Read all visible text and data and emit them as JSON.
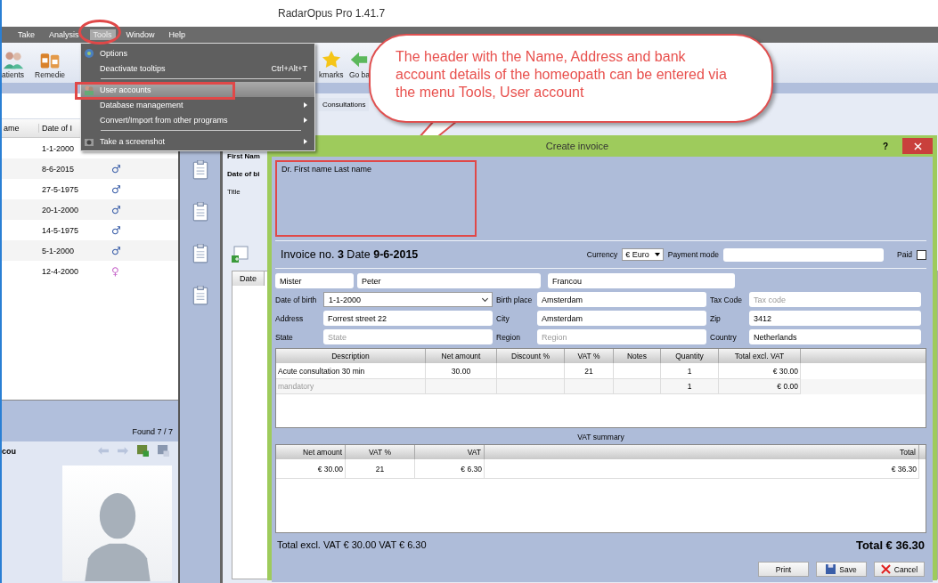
{
  "window": {
    "title": "RadarOpus Pro 1.41.7"
  },
  "menu_bar": [
    {
      "label": "Take",
      "selected": false
    },
    {
      "label": "Analysis",
      "selected": false
    },
    {
      "label": "Tools",
      "selected": true
    },
    {
      "label": "Window",
      "selected": false
    },
    {
      "label": "Help",
      "selected": false
    }
  ],
  "toolbar": [
    {
      "label": "atients"
    },
    {
      "label": "Remedie"
    },
    {
      "label": "kmarks"
    },
    {
      "label": "Go ba"
    }
  ],
  "tools_menu": [
    {
      "label": "Options",
      "submenu": false,
      "highlighted": false,
      "separator_after": false
    },
    {
      "label": "Deactivate tooltips",
      "shortcut": "Ctrl+Alt+T",
      "submenu": false,
      "highlighted": false,
      "separator_after": true
    },
    {
      "label": "User accounts",
      "submenu": false,
      "highlighted": true,
      "separator_after": false
    },
    {
      "label": "Database management",
      "submenu": true,
      "highlighted": false,
      "separator_after": false
    },
    {
      "label": "Convert/Import from other programs",
      "submenu": true,
      "highlighted": false,
      "separator_after": true
    },
    {
      "label": "Take a screenshot",
      "submenu": true,
      "highlighted": false,
      "separator_after": false
    }
  ],
  "patients": {
    "columns": [
      "ame",
      "Date of I"
    ],
    "rows": [
      {
        "date": "1-1-2000"
      },
      {
        "date": "8-6-2015",
        "symbol": "♂",
        "kind": "male"
      },
      {
        "date": "27-5-1975",
        "symbol": "♂",
        "kind": "male"
      },
      {
        "date": "20-1-2000",
        "symbol": "♂",
        "kind": "male"
      },
      {
        "date": "14-5-1975",
        "symbol": "♂",
        "kind": "male"
      },
      {
        "date": "5-1-2000",
        "symbol": "♂",
        "kind": "male"
      },
      {
        "date": "12-4-2000",
        "symbol": "♀",
        "kind": "female"
      }
    ],
    "found": "Found  7  /  7",
    "patient_name": "cou"
  },
  "consultations": {
    "tab": "Consultations",
    "labels": [
      "First Nam",
      "Date of bi",
      "Title"
    ],
    "column": "Date"
  },
  "callout": "The header with the Name, Address and bank account details  of the homeopath can be entered via the menu Tools,  User account",
  "dialog": {
    "title": "Create invoice",
    "help": "?",
    "header_text": "Dr. First name Last name",
    "invoice_line": "Invoice no. **3** Date **9-6-2015**",
    "currency_label": "Currency",
    "currency": "€ Euro",
    "payment_mode_label": "Payment mode",
    "paid_label": "Paid",
    "paid": false,
    "name_fields": [
      "Mister",
      "Peter",
      "Francou"
    ],
    "person_fields": [
      {
        "label": "Date of birth",
        "value": "1-1-2000",
        "kind": "select"
      },
      {
        "label": "Birth place",
        "value": "Amsterdam",
        "kind": "text"
      },
      {
        "label": "Tax Code",
        "placeholder": "Tax code",
        "kind": "text"
      },
      {
        "label": "Address",
        "value": "Forrest street 22",
        "kind": "text"
      },
      {
        "label": "City",
        "value": "Amsterdam",
        "kind": "text"
      },
      {
        "label": "Zip",
        "value": "3412",
        "kind": "text"
      },
      {
        "label": "State",
        "placeholder": "State",
        "kind": "text"
      },
      {
        "label": "Region",
        "placeholder": "Region",
        "kind": "text"
      },
      {
        "label": "Country",
        "value": "Netherlands",
        "kind": "text"
      }
    ],
    "items": {
      "columns": [
        "Description",
        "Net amount",
        "Discount %",
        "VAT %",
        "Notes",
        "Quantity",
        "Total excl. VAT"
      ],
      "rows": [
        {
          "description": "Acute consultation 30 min",
          "net_amount": "30.00",
          "vat_pct": "21",
          "quantity": "1",
          "total": "€ 30.00"
        },
        {
          "description_placeholder": "mandatory",
          "quantity": "1",
          "total": "€ 0.00"
        }
      ]
    },
    "vat_summary": {
      "title": "VAT summary",
      "columns": [
        "Net amount",
        "VAT %",
        "VAT",
        "Total"
      ],
      "rows": [
        [
          "€ 30.00",
          "21",
          "€ 6.30",
          "€ 36.30"
        ]
      ]
    },
    "totals_left": "Total excl. VAT  € 30.00  VAT  € 6.30",
    "total": "Total € 36.30",
    "buttons": [
      {
        "label": "Print",
        "kind": "print"
      },
      {
        "label": "Save",
        "kind": "save"
      },
      {
        "label": "Cancel",
        "kind": "cancel"
      }
    ]
  }
}
